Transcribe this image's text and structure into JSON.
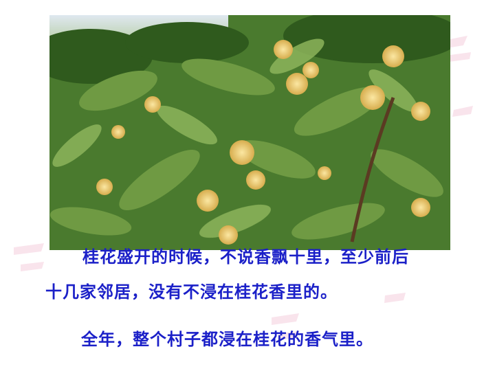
{
  "slide": {
    "photo": {
      "subject": "osmanthus-tree-photo"
    },
    "paragraph": {
      "line1": "桂花盛开的时候，不说香飘十里，至少前后",
      "line2": "十几家邻居，没有不浸在桂花香里的。"
    },
    "sentence": "全年，整个村子都浸在桂花的香气里。",
    "colors": {
      "text": "#1b20c8",
      "leaf": "#3f6e2a",
      "flower": "#e9c76a",
      "deco": "#f6d9e4"
    }
  }
}
